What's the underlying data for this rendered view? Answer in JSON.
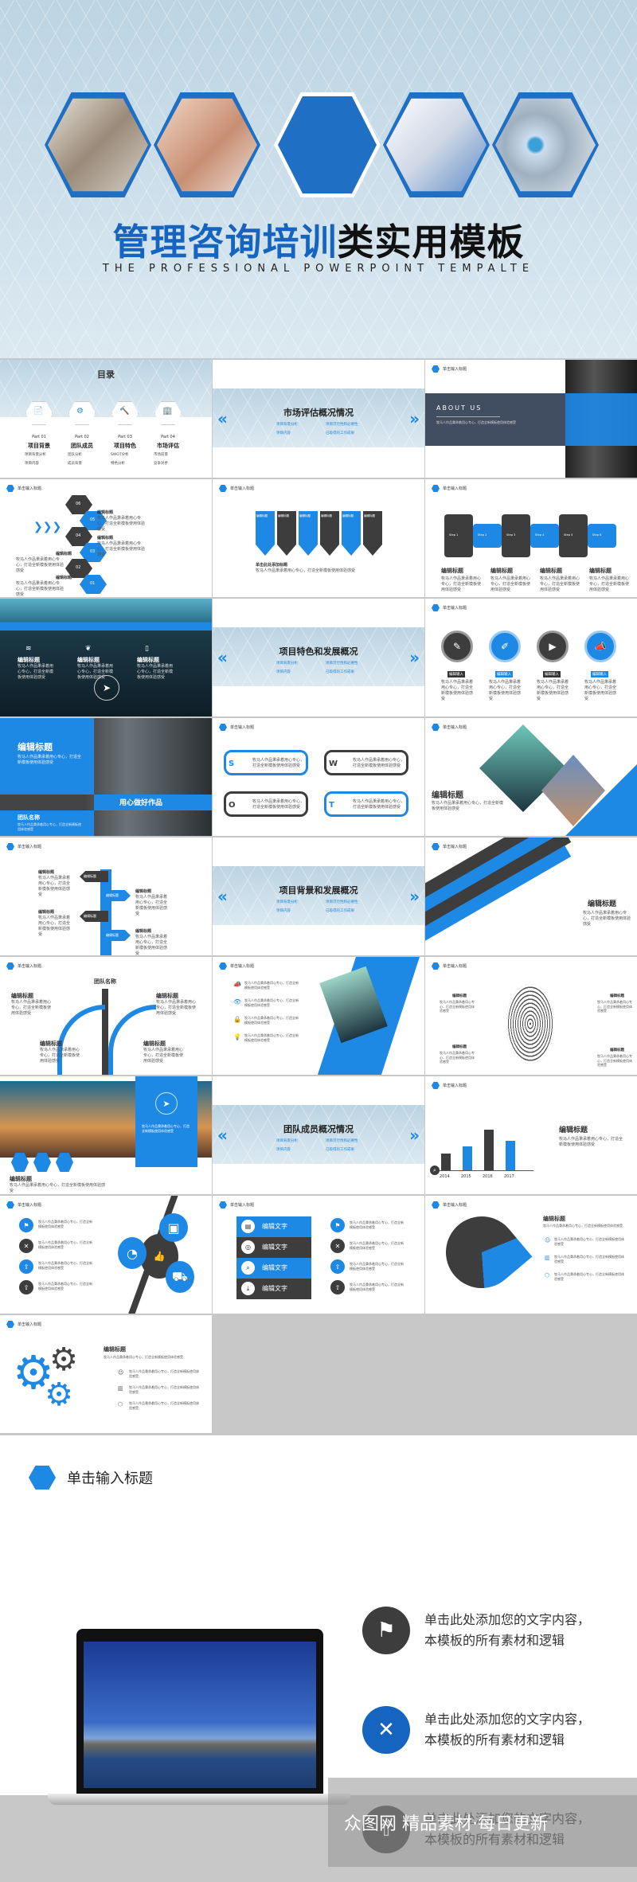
{
  "colors": {
    "accent": "#1e88e5",
    "dark": "#3d3d3d",
    "band": "#cddfea",
    "about_panel": "#414d60"
  },
  "cover": {
    "title_blue": "管理咨询培训",
    "title_black": "类实用模板",
    "subtitle": "THE PROFESSIONAL POWERPOINT TEMPALTE"
  },
  "header_label": "单击输入标题",
  "body_text": "牧马人作品秉承着用心专心，打造全新模板使用体验感受",
  "click_text": "单击此处添加您的文字内容，本模板的所有素材和逻辑",
  "edit_title": "编辑标题",
  "edit_input": "编辑输入",
  "edit_text": "编辑文字",
  "toc": {
    "title": "目录",
    "parts": [
      {
        "part": "Part 01",
        "name": "项目背景",
        "items": [
          "项目背景分析",
          "项目内容"
        ]
      },
      {
        "part": "Part 02",
        "name": "团队成员",
        "items": [
          "团队分析",
          "成员背景"
        ]
      },
      {
        "part": "Part 03",
        "name": "项目特色",
        "items": [
          "SWOT分析",
          "特色分析"
        ]
      },
      {
        "part": "Part 04",
        "name": "市场评估",
        "items": [
          "市场前景",
          "竞争对手"
        ]
      }
    ]
  },
  "section_items": [
    "项目背景分析",
    "项目可行性和必要性",
    "项目内容",
    "已取得的工作成果"
  ],
  "sections": [
    "市场评估概况情况",
    "项目特色和发展概况",
    "项目背景和发展概况",
    "团队成员概况情况"
  ],
  "about": {
    "title": "ABOUT US"
  },
  "hex_numbers": [
    "06",
    "05",
    "04",
    "03",
    "02",
    "01"
  ],
  "banner_heading": "单击此处添加标题",
  "puzzle_steps": [
    "Step 1",
    "Step 2",
    "Step 3",
    "Step 4",
    "Step 5",
    "Step 6"
  ],
  "photo_slide": {
    "slogan": "用心做好作品",
    "team": "团队名称"
  },
  "swot": [
    "S",
    "W",
    "O",
    "T"
  ],
  "arrow_label": "输入您的一级标题",
  "team_name": "团队名称",
  "bar_chart": {
    "years": [
      "2014",
      "2015",
      "2016",
      "2017"
    ],
    "levels": [
      0.35,
      0.5,
      0.85,
      0.62
    ]
  },
  "watermark": "众图网  精品素材·每日更新",
  "icons": {
    "list": [
      "flag-icon",
      "tools-icon",
      "upload-icon"
    ]
  }
}
